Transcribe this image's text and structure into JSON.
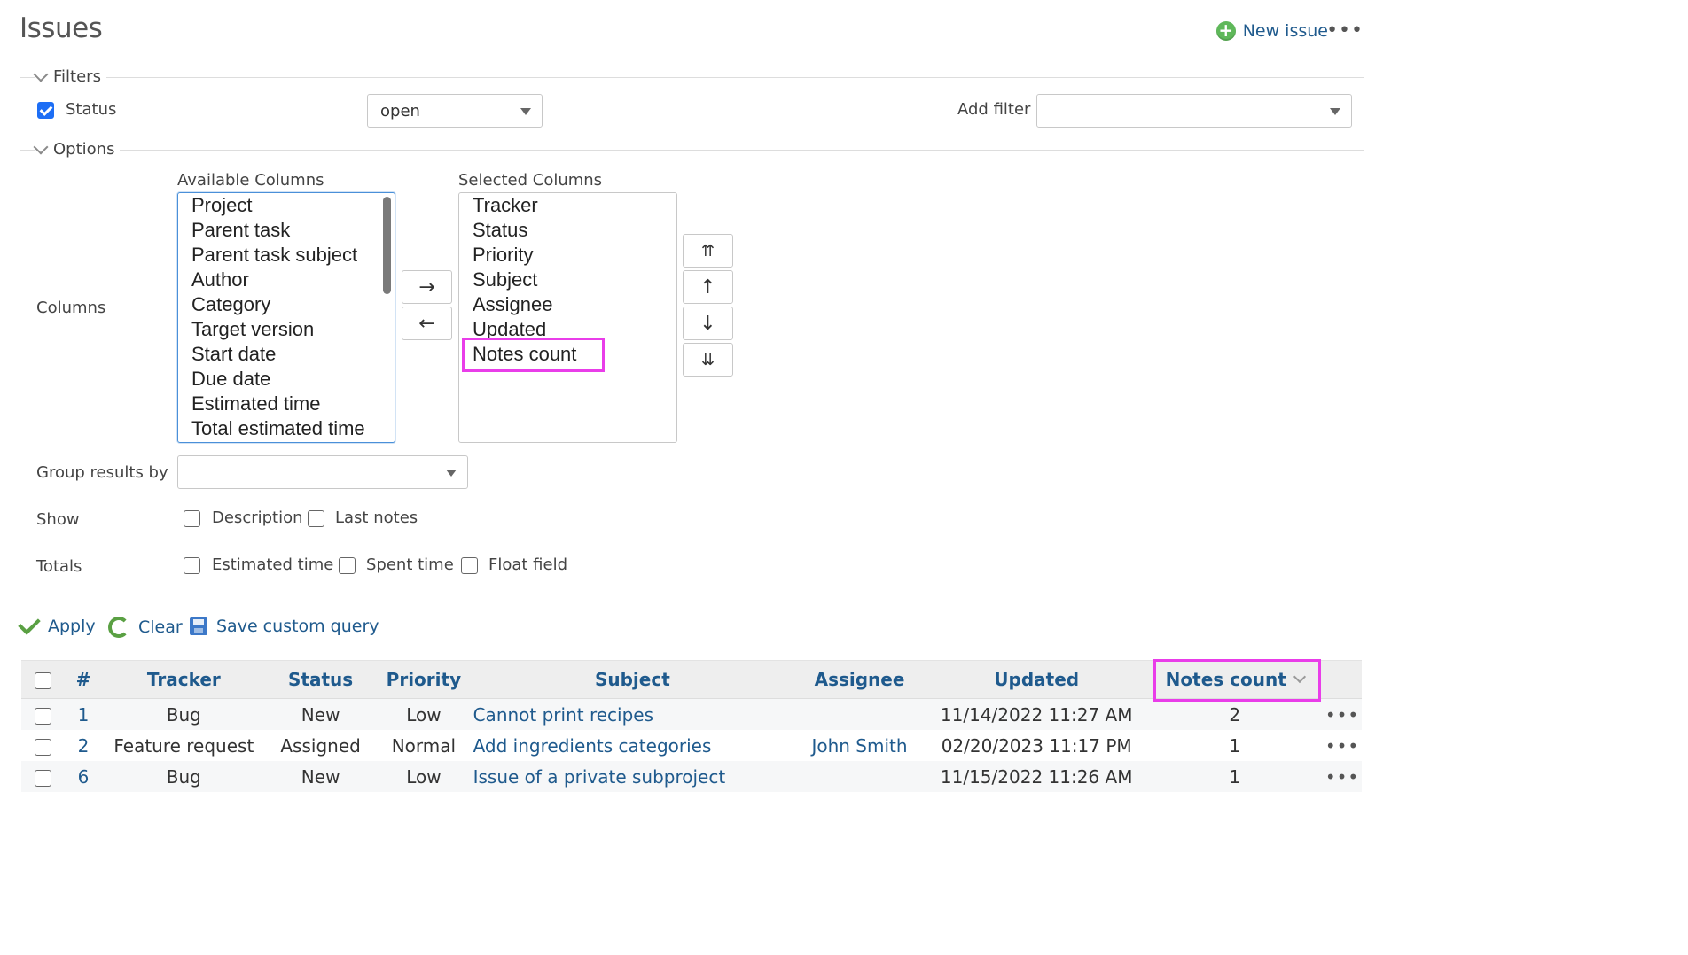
{
  "header": {
    "title": "Issues",
    "new_issue": "New issue",
    "menu": "•••"
  },
  "filters": {
    "legend": "Filters",
    "status_label": "Status",
    "status_checked": true,
    "status_value": "open",
    "add_filter_label": "Add filter",
    "add_filter_value": ""
  },
  "options": {
    "legend": "Options",
    "columns_label": "Columns",
    "available_label": "Available Columns",
    "selected_label": "Selected Columns",
    "available": [
      "Project",
      "Parent task",
      "Parent task subject",
      "Author",
      "Category",
      "Target version",
      "Start date",
      "Due date",
      "Estimated time",
      "Total estimated time"
    ],
    "selected": [
      "Tracker",
      "Status",
      "Priority",
      "Subject",
      "Assignee",
      "Updated",
      "Notes count"
    ],
    "add_arrow": "→",
    "remove_arrow": "←",
    "move_top": "⇈",
    "move_up": "↑",
    "move_down": "↓",
    "move_bottom": "⇊",
    "group_label": "Group results by",
    "group_value": "",
    "show_label": "Show",
    "show_description": "Description",
    "show_last_notes": "Last notes",
    "totals_label": "Totals",
    "totals_estimated": "Estimated time",
    "totals_spent": "Spent time",
    "totals_float": "Float field"
  },
  "actions": {
    "apply": "Apply",
    "clear": "Clear",
    "save": "Save custom query"
  },
  "table": {
    "headers": {
      "id": "#",
      "tracker": "Tracker",
      "status": "Status",
      "priority": "Priority",
      "subject": "Subject",
      "assignee": "Assignee",
      "updated": "Updated",
      "notes_count": "Notes count"
    },
    "rows": [
      {
        "id": "1",
        "tracker": "Bug",
        "status": "New",
        "priority": "Low",
        "subject": "Cannot print recipes",
        "assignee": "",
        "updated": "11/14/2022 11:27 AM",
        "notes_count": "2",
        "menu": "•••"
      },
      {
        "id": "2",
        "tracker": "Feature request",
        "status": "Assigned",
        "priority": "Normal",
        "subject": "Add ingredients categories",
        "assignee": "John Smith",
        "updated": "02/20/2023 11:17 PM",
        "notes_count": "1",
        "menu": "•••"
      },
      {
        "id": "6",
        "tracker": "Bug",
        "status": "New",
        "priority": "Low",
        "subject": "Issue of a private subproject",
        "assignee": "",
        "updated": "11/15/2022 11:26 AM",
        "notes_count": "1",
        "menu": "•••"
      }
    ]
  },
  "colors": {
    "link": "#1f5a8d",
    "highlight": "#e93de9",
    "checkbox_checked": "#1d6ef5",
    "header_bg": "#eeeeee"
  }
}
